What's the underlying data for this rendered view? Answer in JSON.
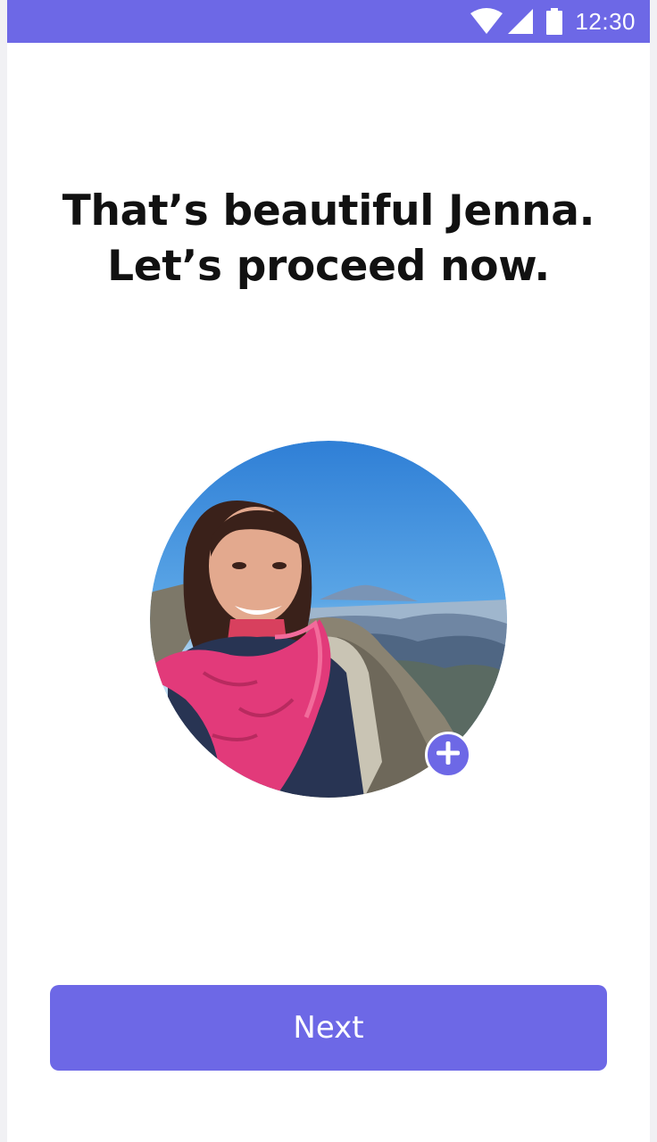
{
  "status_bar": {
    "time": "12:30",
    "icons": [
      "wifi-icon",
      "cellular-signal-icon",
      "battery-icon"
    ],
    "background": "#6d68e6"
  },
  "headline": {
    "line1": "That’s beautiful Jenna.",
    "line2": "Let’s proceed now."
  },
  "avatar": {
    "alt": "Profile photo",
    "add_icon": "plus-icon"
  },
  "actions": {
    "next_label": "Next"
  },
  "colors": {
    "accent": "#6d68e6",
    "text": "#111111",
    "background": "#ffffff"
  }
}
